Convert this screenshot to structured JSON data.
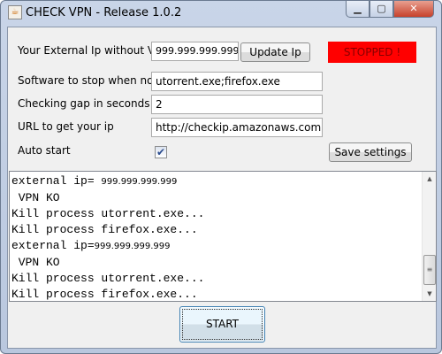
{
  "window": {
    "title": "CHECK VPN - Release 1.0.2",
    "icon": "java-cup-icon",
    "controls": [
      "minimize",
      "maximize",
      "close"
    ]
  },
  "form": {
    "ip_label": "Your External Ip without VPN",
    "ip_value": "999.999.999.999",
    "update_button": "Update Ip",
    "status": "STOPPED !",
    "status_color": "#ff0000",
    "software_label": "Software to stop when no VPN",
    "software_value": "utorrent.exe;firefox.exe",
    "gap_label": "Checking gap in seconds",
    "gap_value": "2",
    "url_label": "URL to get your ip",
    "url_value": "http://checkip.amazonaws.com",
    "autostart_label": "Auto start",
    "autostart_checked": true,
    "save_button": "Save settings"
  },
  "log": [
    {
      "text": "external ip= ",
      "ip": "999.999.999.999"
    },
    {
      "text": " VPN KO"
    },
    {
      "text": "Kill process utorrent.exe..."
    },
    {
      "text": "Kill process firefox.exe..."
    },
    {
      "text": "external ip=",
      "ip": "999.999.999.999"
    },
    {
      "text": " VPN KO"
    },
    {
      "text": "Kill process utorrent.exe..."
    },
    {
      "text": "Kill process firefox.exe..."
    }
  ],
  "start_button": "START"
}
